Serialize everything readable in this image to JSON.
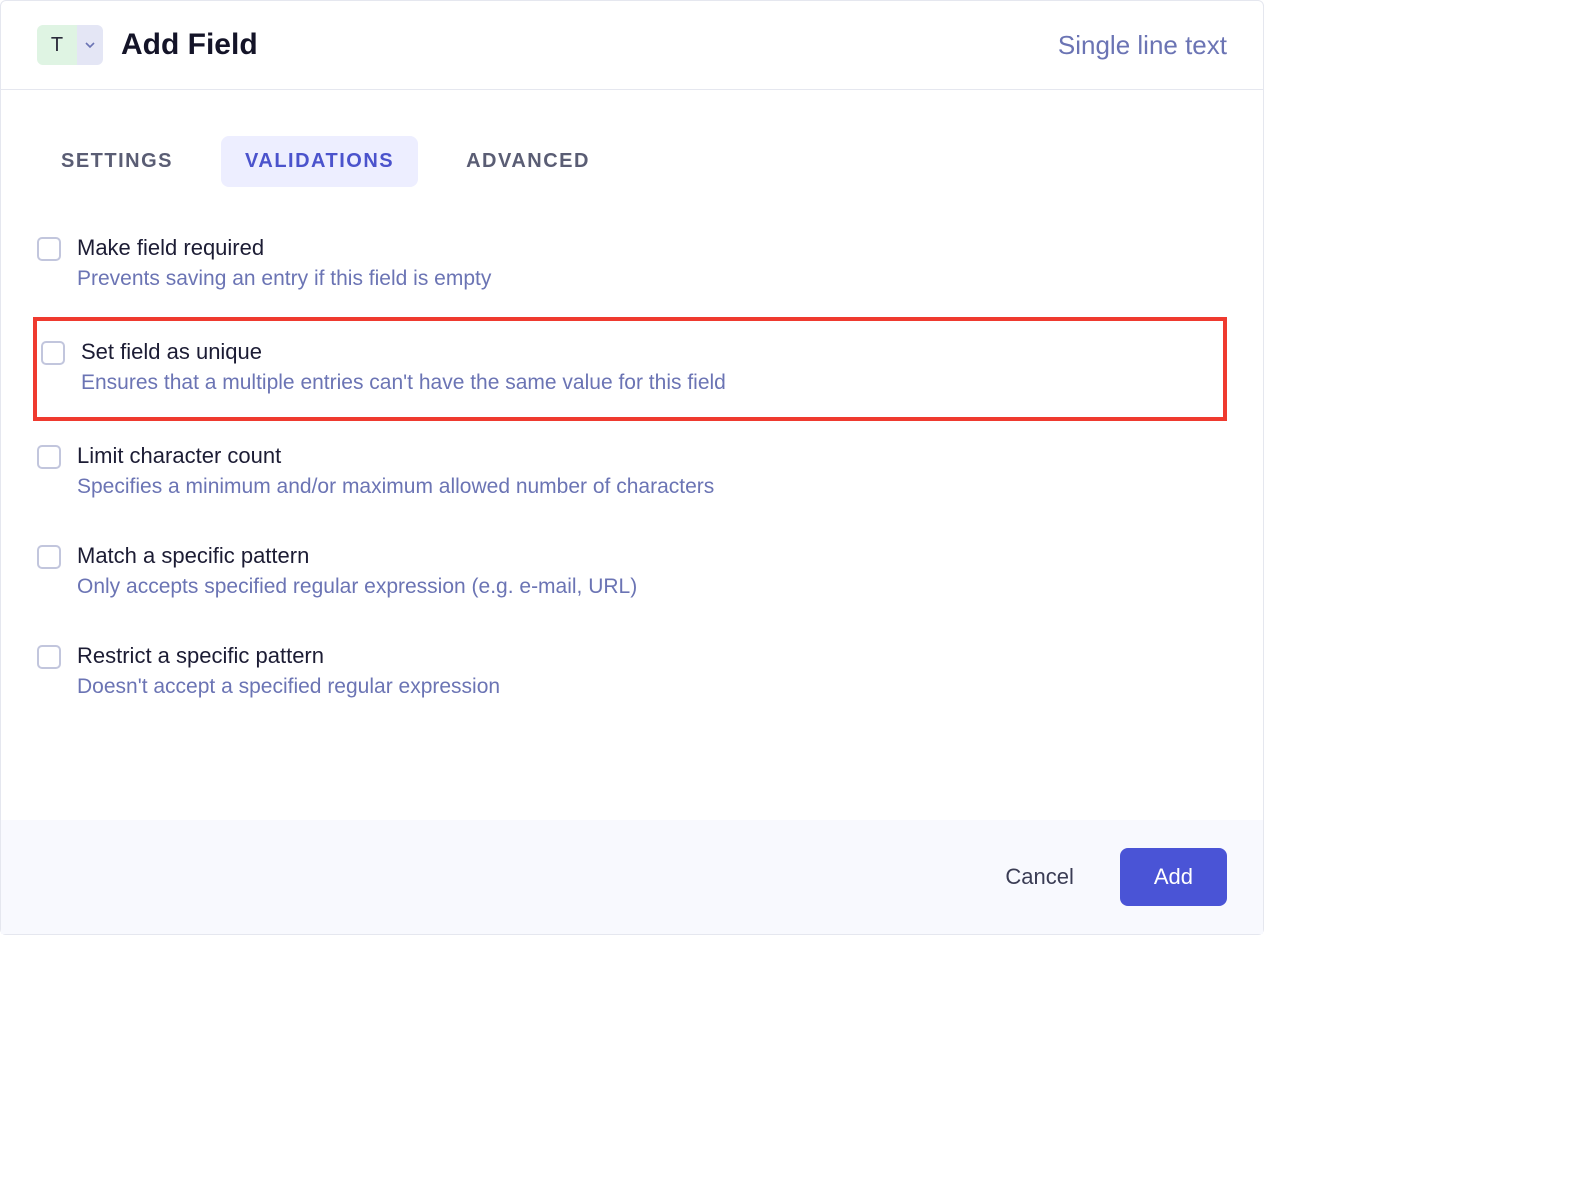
{
  "header": {
    "badge_letter": "T",
    "title": "Add Field",
    "field_type": "Single line text"
  },
  "tabs": [
    {
      "label": "SETTINGS",
      "active": false
    },
    {
      "label": "VALIDATIONS",
      "active": true
    },
    {
      "label": "ADVANCED",
      "active": false
    }
  ],
  "options": [
    {
      "id": "required",
      "title": "Make field required",
      "desc": "Prevents saving an entry if this field is empty",
      "highlight": false
    },
    {
      "id": "unique",
      "title": "Set field as unique",
      "desc": "Ensures that a multiple entries can't have the same value for this field",
      "highlight": true
    },
    {
      "id": "limit",
      "title": "Limit character count",
      "desc": "Specifies a minimum and/or maximum allowed number of characters",
      "highlight": false
    },
    {
      "id": "match",
      "title": "Match a specific pattern",
      "desc": "Only accepts specified regular expression (e.g. e-mail, URL)",
      "highlight": false
    },
    {
      "id": "restrict",
      "title": "Restrict a specific pattern",
      "desc": "Doesn't accept a specified regular expression",
      "highlight": false
    }
  ],
  "footer": {
    "cancel": "Cancel",
    "add": "Add"
  }
}
